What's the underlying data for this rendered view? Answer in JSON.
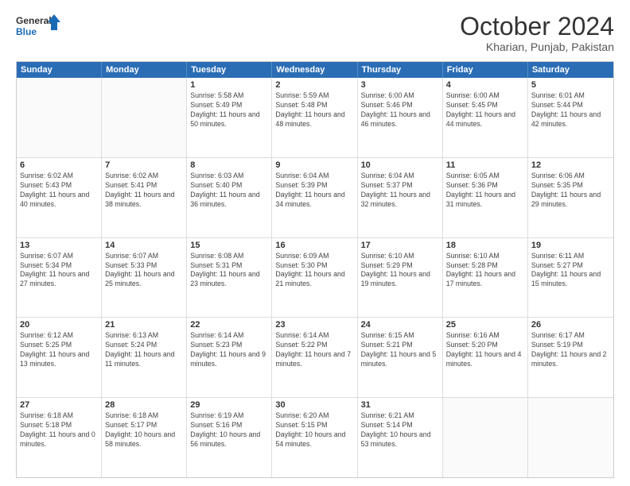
{
  "header": {
    "logo_line1": "General",
    "logo_line2": "Blue",
    "month": "October 2024",
    "location": "Kharian, Punjab, Pakistan"
  },
  "days_of_week": [
    "Sunday",
    "Monday",
    "Tuesday",
    "Wednesday",
    "Thursday",
    "Friday",
    "Saturday"
  ],
  "weeks": [
    [
      {
        "day": "",
        "sunrise": "",
        "sunset": "",
        "daylight": ""
      },
      {
        "day": "",
        "sunrise": "",
        "sunset": "",
        "daylight": ""
      },
      {
        "day": "1",
        "sunrise": "Sunrise: 5:58 AM",
        "sunset": "Sunset: 5:49 PM",
        "daylight": "Daylight: 11 hours and 50 minutes."
      },
      {
        "day": "2",
        "sunrise": "Sunrise: 5:59 AM",
        "sunset": "Sunset: 5:48 PM",
        "daylight": "Daylight: 11 hours and 48 minutes."
      },
      {
        "day": "3",
        "sunrise": "Sunrise: 6:00 AM",
        "sunset": "Sunset: 5:46 PM",
        "daylight": "Daylight: 11 hours and 46 minutes."
      },
      {
        "day": "4",
        "sunrise": "Sunrise: 6:00 AM",
        "sunset": "Sunset: 5:45 PM",
        "daylight": "Daylight: 11 hours and 44 minutes."
      },
      {
        "day": "5",
        "sunrise": "Sunrise: 6:01 AM",
        "sunset": "Sunset: 5:44 PM",
        "daylight": "Daylight: 11 hours and 42 minutes."
      }
    ],
    [
      {
        "day": "6",
        "sunrise": "Sunrise: 6:02 AM",
        "sunset": "Sunset: 5:43 PM",
        "daylight": "Daylight: 11 hours and 40 minutes."
      },
      {
        "day": "7",
        "sunrise": "Sunrise: 6:02 AM",
        "sunset": "Sunset: 5:41 PM",
        "daylight": "Daylight: 11 hours and 38 minutes."
      },
      {
        "day": "8",
        "sunrise": "Sunrise: 6:03 AM",
        "sunset": "Sunset: 5:40 PM",
        "daylight": "Daylight: 11 hours and 36 minutes."
      },
      {
        "day": "9",
        "sunrise": "Sunrise: 6:04 AM",
        "sunset": "Sunset: 5:39 PM",
        "daylight": "Daylight: 11 hours and 34 minutes."
      },
      {
        "day": "10",
        "sunrise": "Sunrise: 6:04 AM",
        "sunset": "Sunset: 5:37 PM",
        "daylight": "Daylight: 11 hours and 32 minutes."
      },
      {
        "day": "11",
        "sunrise": "Sunrise: 6:05 AM",
        "sunset": "Sunset: 5:36 PM",
        "daylight": "Daylight: 11 hours and 31 minutes."
      },
      {
        "day": "12",
        "sunrise": "Sunrise: 6:06 AM",
        "sunset": "Sunset: 5:35 PM",
        "daylight": "Daylight: 11 hours and 29 minutes."
      }
    ],
    [
      {
        "day": "13",
        "sunrise": "Sunrise: 6:07 AM",
        "sunset": "Sunset: 5:34 PM",
        "daylight": "Daylight: 11 hours and 27 minutes."
      },
      {
        "day": "14",
        "sunrise": "Sunrise: 6:07 AM",
        "sunset": "Sunset: 5:33 PM",
        "daylight": "Daylight: 11 hours and 25 minutes."
      },
      {
        "day": "15",
        "sunrise": "Sunrise: 6:08 AM",
        "sunset": "Sunset: 5:31 PM",
        "daylight": "Daylight: 11 hours and 23 minutes."
      },
      {
        "day": "16",
        "sunrise": "Sunrise: 6:09 AM",
        "sunset": "Sunset: 5:30 PM",
        "daylight": "Daylight: 11 hours and 21 minutes."
      },
      {
        "day": "17",
        "sunrise": "Sunrise: 6:10 AM",
        "sunset": "Sunset: 5:29 PM",
        "daylight": "Daylight: 11 hours and 19 minutes."
      },
      {
        "day": "18",
        "sunrise": "Sunrise: 6:10 AM",
        "sunset": "Sunset: 5:28 PM",
        "daylight": "Daylight: 11 hours and 17 minutes."
      },
      {
        "day": "19",
        "sunrise": "Sunrise: 6:11 AM",
        "sunset": "Sunset: 5:27 PM",
        "daylight": "Daylight: 11 hours and 15 minutes."
      }
    ],
    [
      {
        "day": "20",
        "sunrise": "Sunrise: 6:12 AM",
        "sunset": "Sunset: 5:25 PM",
        "daylight": "Daylight: 11 hours and 13 minutes."
      },
      {
        "day": "21",
        "sunrise": "Sunrise: 6:13 AM",
        "sunset": "Sunset: 5:24 PM",
        "daylight": "Daylight: 11 hours and 11 minutes."
      },
      {
        "day": "22",
        "sunrise": "Sunrise: 6:14 AM",
        "sunset": "Sunset: 5:23 PM",
        "daylight": "Daylight: 11 hours and 9 minutes."
      },
      {
        "day": "23",
        "sunrise": "Sunrise: 6:14 AM",
        "sunset": "Sunset: 5:22 PM",
        "daylight": "Daylight: 11 hours and 7 minutes."
      },
      {
        "day": "24",
        "sunrise": "Sunrise: 6:15 AM",
        "sunset": "Sunset: 5:21 PM",
        "daylight": "Daylight: 11 hours and 5 minutes."
      },
      {
        "day": "25",
        "sunrise": "Sunrise: 6:16 AM",
        "sunset": "Sunset: 5:20 PM",
        "daylight": "Daylight: 11 hours and 4 minutes."
      },
      {
        "day": "26",
        "sunrise": "Sunrise: 6:17 AM",
        "sunset": "Sunset: 5:19 PM",
        "daylight": "Daylight: 11 hours and 2 minutes."
      }
    ],
    [
      {
        "day": "27",
        "sunrise": "Sunrise: 6:18 AM",
        "sunset": "Sunset: 5:18 PM",
        "daylight": "Daylight: 11 hours and 0 minutes."
      },
      {
        "day": "28",
        "sunrise": "Sunrise: 6:18 AM",
        "sunset": "Sunset: 5:17 PM",
        "daylight": "Daylight: 10 hours and 58 minutes."
      },
      {
        "day": "29",
        "sunrise": "Sunrise: 6:19 AM",
        "sunset": "Sunset: 5:16 PM",
        "daylight": "Daylight: 10 hours and 56 minutes."
      },
      {
        "day": "30",
        "sunrise": "Sunrise: 6:20 AM",
        "sunset": "Sunset: 5:15 PM",
        "daylight": "Daylight: 10 hours and 54 minutes."
      },
      {
        "day": "31",
        "sunrise": "Sunrise: 6:21 AM",
        "sunset": "Sunset: 5:14 PM",
        "daylight": "Daylight: 10 hours and 53 minutes."
      },
      {
        "day": "",
        "sunrise": "",
        "sunset": "",
        "daylight": ""
      },
      {
        "day": "",
        "sunrise": "",
        "sunset": "",
        "daylight": ""
      }
    ]
  ]
}
